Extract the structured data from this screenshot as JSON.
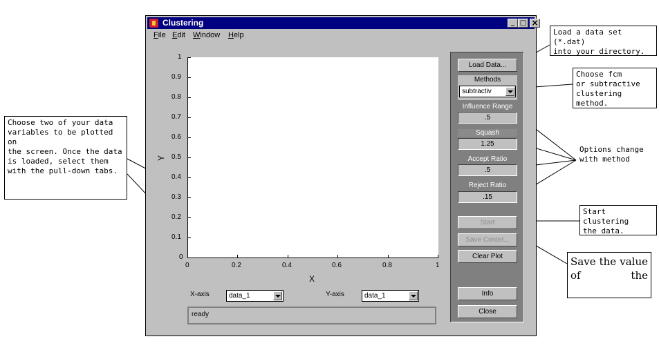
{
  "window": {
    "title": "Clustering",
    "controls": {
      "minimize": "_",
      "maximize": "□",
      "close": "×"
    },
    "menu": [
      {
        "key": "F",
        "rest": "ile"
      },
      {
        "key": "E",
        "rest": "dit"
      },
      {
        "key": "W",
        "rest": "indow"
      },
      {
        "key": "H",
        "rest": "elp"
      }
    ]
  },
  "plot": {
    "y_label": "Y",
    "x_label": "X",
    "y_ticks": [
      "1",
      "0.9",
      "0.8",
      "0.7",
      "0.6",
      "0.5",
      "0.4",
      "0.3",
      "0.2",
      "0.1",
      "0"
    ],
    "x_ticks": [
      "0",
      "0.2",
      "0.4",
      "0.6",
      "0.8",
      "1"
    ]
  },
  "controls": {
    "x_axis_label": "X-axis",
    "x_axis_value": "data_1",
    "y_axis_label": "Y-axis",
    "y_axis_value": "data_1",
    "status": "ready"
  },
  "panel": {
    "load_data": "Load Data...",
    "methods_label": "Methods",
    "methods_value": "subtractiv",
    "influence_label": "Influence Range",
    "influence_value": ".5",
    "squash_label": "Squash",
    "squash_value": "1.25",
    "accept_label": "Accept Ratio",
    "accept_value": ".5",
    "reject_label": "Reject Ratio",
    "reject_value": ".15",
    "start": "Start",
    "save_center": "Save Center...",
    "clear_plot": "Clear Plot",
    "info": "Info",
    "close": "Close"
  },
  "annotations": {
    "load": "Load a data set (*.dat)\ninto your directory.",
    "method": "Choose fcm\nor subtractive\nclustering method.",
    "options": "Options change\nwith method",
    "start": "Start clustering\nthe data.",
    "save": "Save the value of the",
    "choose": "Choose two of your data\nvariables to be plotted on\nthe screen. Once the data\nis loaded, select them\nwith the pull-down tabs."
  }
}
